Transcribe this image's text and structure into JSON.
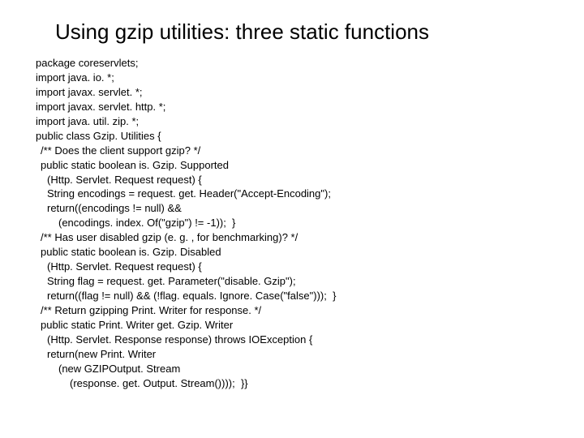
{
  "title": "Using gzip utilities: three static functions",
  "code": {
    "l0": "package coreservlets;",
    "l1": "import java. io. *;",
    "l2": "import javax. servlet. *;",
    "l3": "import javax. servlet. http. *;",
    "l4": "import java. util. zip. *;",
    "l5": "public class Gzip. Utilities {",
    "l6": "/** Does the client support gzip? */",
    "l7": "public static boolean is. Gzip. Supported",
    "l8": "(Http. Servlet. Request request) {",
    "l9": "String encodings = request. get. Header(\"Accept-Encoding\");",
    "l10": "return((encodings != null) &&",
    "l11": "(encodings. index. Of(\"gzip\") != -1));  }",
    "l12": "/** Has user disabled gzip (e. g. , for benchmarking)? */",
    "l13": "public static boolean is. Gzip. Disabled",
    "l14": "(Http. Servlet. Request request) {",
    "l15": "String flag = request. get. Parameter(\"disable. Gzip\");",
    "l16": "return((flag != null) && (!flag. equals. Ignore. Case(\"false\")));  }",
    "l17": "/** Return gzipping Print. Writer for response. */",
    "l18": "public static Print. Writer get. Gzip. Writer",
    "l19": "(Http. Servlet. Response response) throws IOException {",
    "l20": "return(new Print. Writer",
    "l21": "(new GZIPOutput. Stream",
    "l22": "(response. get. Output. Stream())));  }}"
  }
}
